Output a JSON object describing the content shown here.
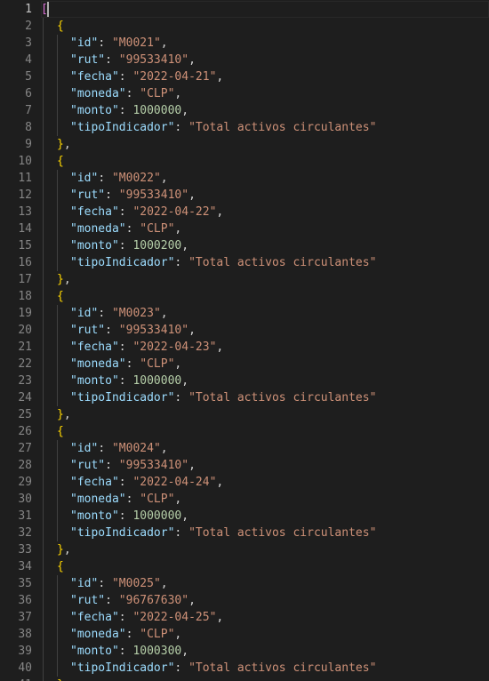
{
  "editor": {
    "first_line": 1,
    "current_line": 1,
    "indent_unit": "  ",
    "open_bracket": "[",
    "records": [
      {
        "id": "M0021",
        "rut": "99533410",
        "fecha": "2022-04-21",
        "moneda": "CLP",
        "monto": "1000000",
        "tipoIndicador": "Total activos circulantes"
      },
      {
        "id": "M0022",
        "rut": "99533410",
        "fecha": "2022-04-22",
        "moneda": "CLP",
        "monto": "1000200",
        "tipoIndicador": "Total activos circulantes"
      },
      {
        "id": "M0023",
        "rut": "99533410",
        "fecha": "2022-04-23",
        "moneda": "CLP",
        "monto": "1000000",
        "tipoIndicador": "Total activos circulantes"
      },
      {
        "id": "M0024",
        "rut": "99533410",
        "fecha": "2022-04-24",
        "moneda": "CLP",
        "monto": "1000000",
        "tipoIndicador": "Total activos circulantes"
      },
      {
        "id": "M0025",
        "rut": "96767630",
        "fecha": "2022-04-25",
        "moneda": "CLP",
        "monto": "1000300",
        "tipoIndicador": "Total activos circulantes"
      }
    ],
    "field_order": [
      "id",
      "rut",
      "fecha",
      "moneda",
      "monto",
      "tipoIndicador"
    ],
    "numeric_fields": [
      "monto"
    ]
  },
  "colors": {
    "background": "#1e1e1e",
    "line_number": "#858585",
    "key": "#9cdcfe",
    "string": "#ce9178",
    "number": "#b5cea8",
    "bracket": "#da70d6",
    "brace": "#ffd700"
  }
}
